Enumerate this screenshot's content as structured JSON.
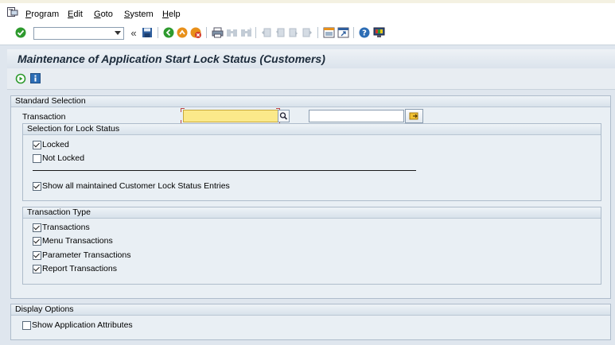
{
  "menu": {
    "items": [
      {
        "label": "Program",
        "key": "P"
      },
      {
        "label": "Edit",
        "key": "E"
      },
      {
        "label": "Goto",
        "key": "G"
      },
      {
        "label": "System",
        "key": "S"
      },
      {
        "label": "Help",
        "key": "H"
      }
    ]
  },
  "toolbar": {
    "command_field": {
      "value": "",
      "placeholder": ""
    },
    "back_chevrons": "«"
  },
  "page": {
    "title": "Maintenance of Application Start Lock Status (Customers)"
  },
  "standard_selection": {
    "header": "Standard Selection",
    "transaction_label": "Transaction",
    "transaction_from": "",
    "transaction_to": ""
  },
  "lock_status": {
    "header": "Selection for Lock Status",
    "locked": {
      "label": "Locked",
      "checked": true
    },
    "not_locked": {
      "label": "Not Locked",
      "checked": false
    },
    "show_all": {
      "label": "Show all maintained Customer Lock Status Entries",
      "checked": true
    }
  },
  "transaction_type": {
    "header": "Transaction Type",
    "items": [
      {
        "label": "Transactions",
        "checked": true
      },
      {
        "label": "Menu Transactions",
        "checked": true
      },
      {
        "label": "Parameter Transactions",
        "checked": true
      },
      {
        "label": "Report Transactions",
        "checked": true
      }
    ]
  },
  "display_options": {
    "header": "Display Options",
    "show_attributes": {
      "label": "Show Application Attributes",
      "checked": false
    }
  },
  "colors": {
    "background": "#dfe6ee",
    "title_text": "#1b2a3a",
    "required_field": "#fbe98a",
    "ok_green": "#2e9a2e",
    "exit_orange": "#e8901a",
    "cancel_red": "#d23a2a",
    "help_blue": "#2c6db5"
  }
}
